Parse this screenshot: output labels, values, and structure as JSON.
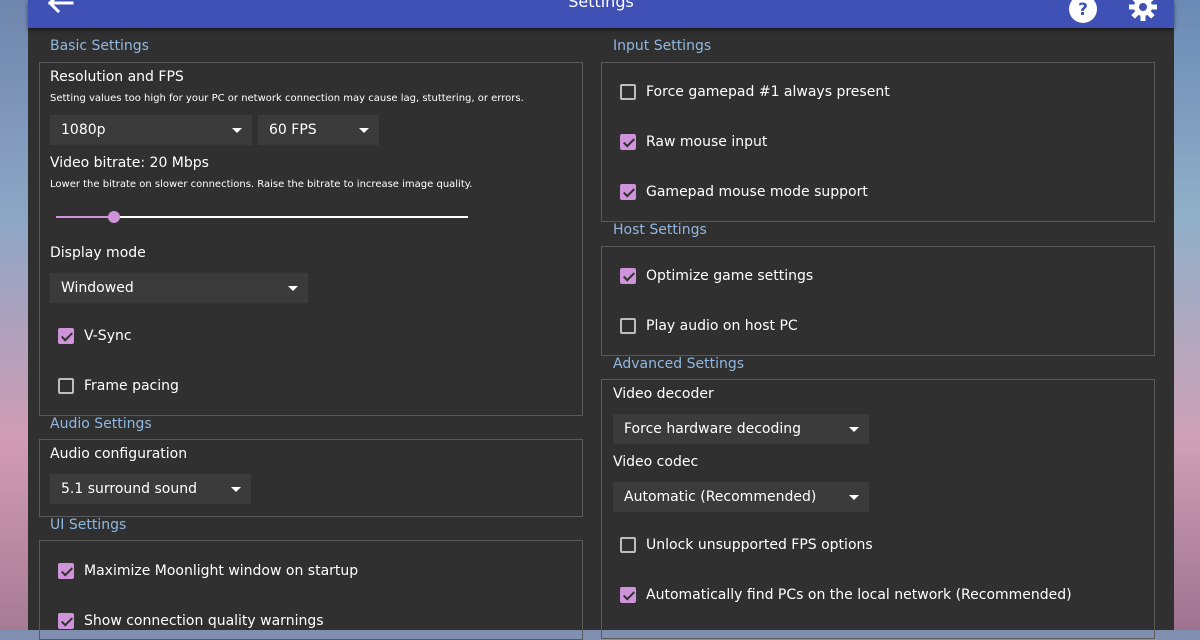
{
  "window": {
    "title": "Settings"
  },
  "colors": {
    "accent": "#ce93d8",
    "header": "#3f51b5",
    "section_title": "#90b8e0",
    "panel_bg": "#303030"
  },
  "icons": {
    "back": "back-arrow-icon",
    "help": "help-icon",
    "settings": "gear-icon"
  },
  "basic": {
    "title": "Basic Settings",
    "resolution_label": "Resolution and FPS",
    "resolution_hint": "Setting values too high for your PC or network connection may cause lag, stuttering, or errors.",
    "resolution_value": "1080p",
    "fps_value": "60 FPS",
    "bitrate_label": "Video bitrate: 20 Mbps",
    "bitrate_hint": "Lower the bitrate on slower connections. Raise the bitrate to increase image quality.",
    "bitrate_slider_fraction": 0.14,
    "display_mode_label": "Display mode",
    "display_mode_value": "Windowed",
    "vsync_label": "V-Sync",
    "vsync_checked": true,
    "frame_pacing_label": "Frame pacing",
    "frame_pacing_checked": false
  },
  "audio": {
    "title": "Audio Settings",
    "config_label": "Audio configuration",
    "config_value": "5.1 surround sound"
  },
  "ui": {
    "title": "UI Settings",
    "maximize_label": "Maximize Moonlight window on startup",
    "maximize_checked": true,
    "quality_warnings_label": "Show connection quality warnings",
    "quality_warnings_checked": true
  },
  "input": {
    "title": "Input Settings",
    "gamepad_present_label": "Force gamepad #1 always present",
    "gamepad_present_checked": false,
    "raw_mouse_label": "Raw mouse input",
    "raw_mouse_checked": true,
    "gamepad_mouse_label": "Gamepad mouse mode support",
    "gamepad_mouse_checked": true
  },
  "host": {
    "title": "Host Settings",
    "optimize_label": "Optimize game settings",
    "optimize_checked": true,
    "play_audio_label": "Play audio on host PC",
    "play_audio_checked": false
  },
  "advanced": {
    "title": "Advanced Settings",
    "decoder_label": "Video decoder",
    "decoder_value": "Force hardware decoding",
    "codec_label": "Video codec",
    "codec_value": "Automatic (Recommended)",
    "unlock_fps_label": "Unlock unsupported FPS options",
    "unlock_fps_checked": false,
    "find_pcs_label": "Automatically find PCs on the local network (Recommended)",
    "find_pcs_checked": true
  }
}
